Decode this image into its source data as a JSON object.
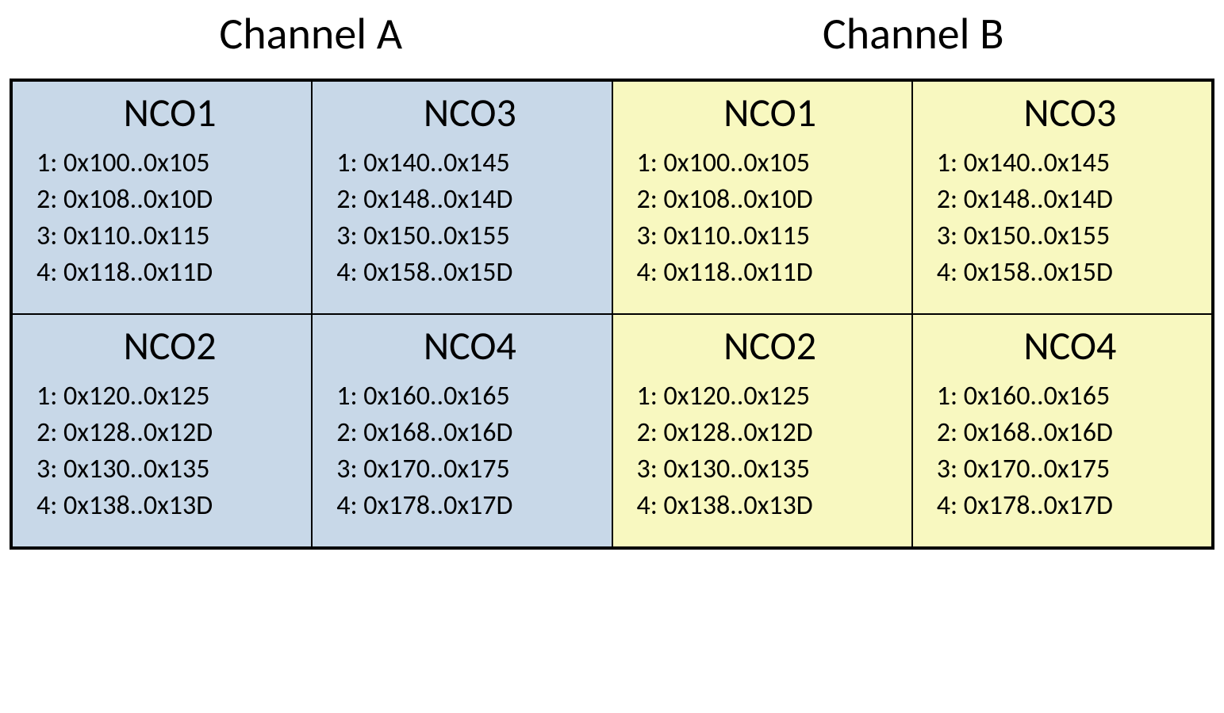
{
  "headers": {
    "a": "Channel A",
    "b": "Channel B"
  },
  "colors": {
    "channel_a_bg": "#c8d8e8",
    "channel_b_bg": "#f8f8c0"
  },
  "cells": {
    "a_nco1": {
      "title": "NCO1",
      "r1": "1: 0x100..0x105",
      "r2": "2: 0x108..0x10D",
      "r3": "3: 0x110..0x115",
      "r4": "4: 0x118..0x11D"
    },
    "a_nco3": {
      "title": "NCO3",
      "r1": "1: 0x140..0x145",
      "r2": "2: 0x148..0x14D",
      "r3": "3: 0x150..0x155",
      "r4": "4: 0x158..0x15D"
    },
    "b_nco1": {
      "title": "NCO1",
      "r1": "1: 0x100..0x105",
      "r2": "2: 0x108..0x10D",
      "r3": "3: 0x110..0x115",
      "r4": "4: 0x118..0x11D"
    },
    "b_nco3": {
      "title": "NCO3",
      "r1": "1: 0x140..0x145",
      "r2": "2: 0x148..0x14D",
      "r3": "3: 0x150..0x155",
      "r4": "4: 0x158..0x15D"
    },
    "a_nco2": {
      "title": "NCO2",
      "r1": "1: 0x120..0x125",
      "r2": "2: 0x128..0x12D",
      "r3": "3: 0x130..0x135",
      "r4": "4: 0x138..0x13D"
    },
    "a_nco4": {
      "title": "NCO4",
      "r1": "1: 0x160..0x165",
      "r2": "2: 0x168..0x16D",
      "r3": "3: 0x170..0x175",
      "r4": "4: 0x178..0x17D"
    },
    "b_nco2": {
      "title": "NCO2",
      "r1": "1: 0x120..0x125",
      "r2": "2: 0x128..0x12D",
      "r3": "3: 0x130..0x135",
      "r4": "4: 0x138..0x13D"
    },
    "b_nco4": {
      "title": "NCO4",
      "r1": "1: 0x160..0x165",
      "r2": "2: 0x168..0x16D",
      "r3": "3: 0x170..0x175",
      "r4": "4: 0x178..0x17D"
    }
  }
}
